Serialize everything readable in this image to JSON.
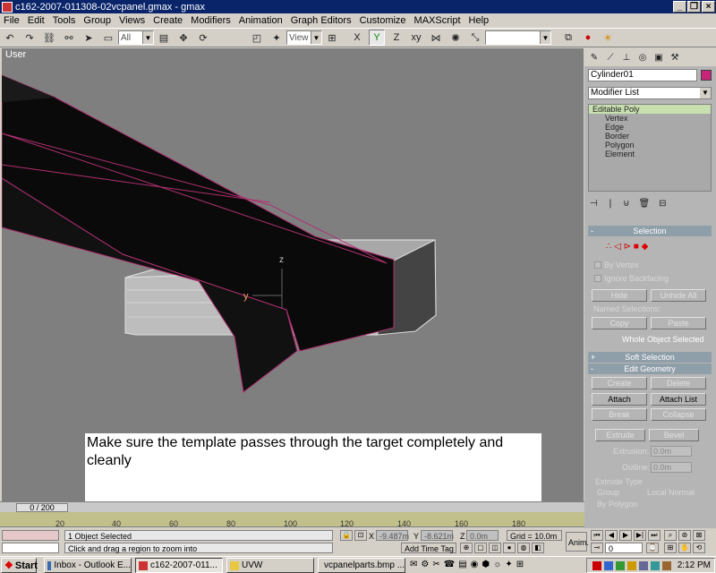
{
  "window": {
    "title": "c162-2007-011308-02vcpanel.gmax - gmax"
  },
  "menu": [
    "File",
    "Edit",
    "Tools",
    "Group",
    "Views",
    "Create",
    "Modifiers",
    "Animation",
    "Graph Editors",
    "Customize",
    "MAXScript",
    "Help"
  ],
  "toolbar": {
    "selection_filter": "All",
    "ref_coord": "View"
  },
  "viewport": {
    "label": "User",
    "axis_z": "z",
    "axis_y": "y"
  },
  "note": {
    "text": "Make sure the template passes through the target completely and cleanly"
  },
  "command_panel": {
    "object_name": "Cylinder01",
    "color": "#c8247a",
    "modifier_list": "Modifier List",
    "stack": [
      "Editable Poly",
      "Vertex",
      "Edge",
      "Border",
      "Polygon",
      "Element"
    ],
    "selection": {
      "title": "Selection",
      "by_vertex": "By Vertex",
      "ignore_backfacing": "Ignore Backfacing",
      "hide": "Hide",
      "unhide_all": "Unhide All",
      "named_selections": "Named Selections:",
      "copy": "Copy",
      "paste": "Paste",
      "status": "Whole Object Selected"
    },
    "soft_selection": "Soft Selection",
    "edit_geometry": {
      "title": "Edit Geometry",
      "create": "Create",
      "delete": "Delete",
      "attach": "Attach",
      "attach_list": "Attach List",
      "break": "Break",
      "collapse": "Collapse",
      "extrude": "Extrude",
      "bevel": "Bevel",
      "extrusion_label": "Extrusion:",
      "extrusion_value": "0.0m",
      "outline_label": "Outline:",
      "outline_value": "0.0m",
      "extrude_type": "Extrude Type",
      "group": "Group",
      "local_normal": "Local Normal",
      "by_polygon": "By Polygon"
    }
  },
  "timeline": {
    "frame": "0 / 200",
    "ticks": [
      "20",
      "40",
      "60",
      "80",
      "100",
      "120",
      "140",
      "160",
      "180"
    ]
  },
  "status": {
    "selected": "1 Object Selected",
    "prompt": "Click and drag a region to zoom into",
    "x_label": "X",
    "x_value": "-9.487m",
    "y_label": "Y",
    "y_value": "-8.621m",
    "z_label": "Z",
    "z_value": "0.0m",
    "grid": "Grid = 10.0m",
    "add_time_tag": "Add Time Tag",
    "anim": "Anim.",
    "frame_value": "0"
  },
  "taskbar": {
    "start": "Start",
    "tasks": [
      "Inbox - Outlook E...",
      "c162-2007-011...",
      "UVW",
      "vcpanelparts.bmp ..."
    ],
    "clock": "2:12 PM"
  }
}
